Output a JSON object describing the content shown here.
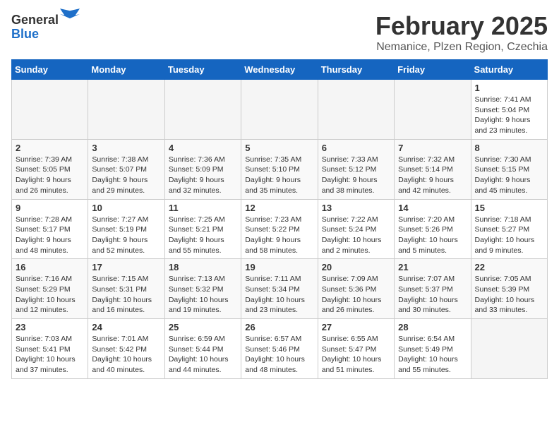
{
  "header": {
    "logo_general": "General",
    "logo_blue": "Blue",
    "title": "February 2025",
    "subtitle": "Nemanice, Plzen Region, Czechia"
  },
  "days_of_week": [
    "Sunday",
    "Monday",
    "Tuesday",
    "Wednesday",
    "Thursday",
    "Friday",
    "Saturday"
  ],
  "weeks": [
    {
      "days": [
        {
          "num": "",
          "info": ""
        },
        {
          "num": "",
          "info": ""
        },
        {
          "num": "",
          "info": ""
        },
        {
          "num": "",
          "info": ""
        },
        {
          "num": "",
          "info": ""
        },
        {
          "num": "",
          "info": ""
        },
        {
          "num": "1",
          "info": "Sunrise: 7:41 AM\nSunset: 5:04 PM\nDaylight: 9 hours and 23 minutes."
        }
      ]
    },
    {
      "days": [
        {
          "num": "2",
          "info": "Sunrise: 7:39 AM\nSunset: 5:05 PM\nDaylight: 9 hours and 26 minutes."
        },
        {
          "num": "3",
          "info": "Sunrise: 7:38 AM\nSunset: 5:07 PM\nDaylight: 9 hours and 29 minutes."
        },
        {
          "num": "4",
          "info": "Sunrise: 7:36 AM\nSunset: 5:09 PM\nDaylight: 9 hours and 32 minutes."
        },
        {
          "num": "5",
          "info": "Sunrise: 7:35 AM\nSunset: 5:10 PM\nDaylight: 9 hours and 35 minutes."
        },
        {
          "num": "6",
          "info": "Sunrise: 7:33 AM\nSunset: 5:12 PM\nDaylight: 9 hours and 38 minutes."
        },
        {
          "num": "7",
          "info": "Sunrise: 7:32 AM\nSunset: 5:14 PM\nDaylight: 9 hours and 42 minutes."
        },
        {
          "num": "8",
          "info": "Sunrise: 7:30 AM\nSunset: 5:15 PM\nDaylight: 9 hours and 45 minutes."
        }
      ]
    },
    {
      "days": [
        {
          "num": "9",
          "info": "Sunrise: 7:28 AM\nSunset: 5:17 PM\nDaylight: 9 hours and 48 minutes."
        },
        {
          "num": "10",
          "info": "Sunrise: 7:27 AM\nSunset: 5:19 PM\nDaylight: 9 hours and 52 minutes."
        },
        {
          "num": "11",
          "info": "Sunrise: 7:25 AM\nSunset: 5:21 PM\nDaylight: 9 hours and 55 minutes."
        },
        {
          "num": "12",
          "info": "Sunrise: 7:23 AM\nSunset: 5:22 PM\nDaylight: 9 hours and 58 minutes."
        },
        {
          "num": "13",
          "info": "Sunrise: 7:22 AM\nSunset: 5:24 PM\nDaylight: 10 hours and 2 minutes."
        },
        {
          "num": "14",
          "info": "Sunrise: 7:20 AM\nSunset: 5:26 PM\nDaylight: 10 hours and 5 minutes."
        },
        {
          "num": "15",
          "info": "Sunrise: 7:18 AM\nSunset: 5:27 PM\nDaylight: 10 hours and 9 minutes."
        }
      ]
    },
    {
      "days": [
        {
          "num": "16",
          "info": "Sunrise: 7:16 AM\nSunset: 5:29 PM\nDaylight: 10 hours and 12 minutes."
        },
        {
          "num": "17",
          "info": "Sunrise: 7:15 AM\nSunset: 5:31 PM\nDaylight: 10 hours and 16 minutes."
        },
        {
          "num": "18",
          "info": "Sunrise: 7:13 AM\nSunset: 5:32 PM\nDaylight: 10 hours and 19 minutes."
        },
        {
          "num": "19",
          "info": "Sunrise: 7:11 AM\nSunset: 5:34 PM\nDaylight: 10 hours and 23 minutes."
        },
        {
          "num": "20",
          "info": "Sunrise: 7:09 AM\nSunset: 5:36 PM\nDaylight: 10 hours and 26 minutes."
        },
        {
          "num": "21",
          "info": "Sunrise: 7:07 AM\nSunset: 5:37 PM\nDaylight: 10 hours and 30 minutes."
        },
        {
          "num": "22",
          "info": "Sunrise: 7:05 AM\nSunset: 5:39 PM\nDaylight: 10 hours and 33 minutes."
        }
      ]
    },
    {
      "days": [
        {
          "num": "23",
          "info": "Sunrise: 7:03 AM\nSunset: 5:41 PM\nDaylight: 10 hours and 37 minutes."
        },
        {
          "num": "24",
          "info": "Sunrise: 7:01 AM\nSunset: 5:42 PM\nDaylight: 10 hours and 40 minutes."
        },
        {
          "num": "25",
          "info": "Sunrise: 6:59 AM\nSunset: 5:44 PM\nDaylight: 10 hours and 44 minutes."
        },
        {
          "num": "26",
          "info": "Sunrise: 6:57 AM\nSunset: 5:46 PM\nDaylight: 10 hours and 48 minutes."
        },
        {
          "num": "27",
          "info": "Sunrise: 6:55 AM\nSunset: 5:47 PM\nDaylight: 10 hours and 51 minutes."
        },
        {
          "num": "28",
          "info": "Sunrise: 6:54 AM\nSunset: 5:49 PM\nDaylight: 10 hours and 55 minutes."
        },
        {
          "num": "",
          "info": ""
        }
      ]
    }
  ]
}
